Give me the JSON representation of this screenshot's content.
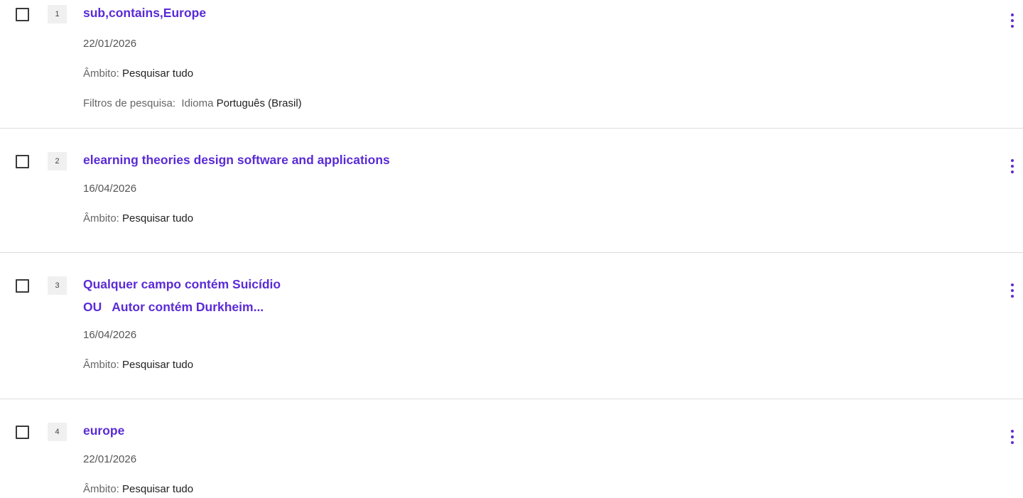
{
  "results": [
    {
      "number": "1",
      "title_lines": [
        "sub,contains,Europe"
      ],
      "date": "22/01/2026",
      "scope_label": "Âmbito:",
      "scope_value": "Pesquisar tudo",
      "filters_label": "Filtros de pesquisa:",
      "filter_name": "Idioma",
      "filter_value": "Português (Brasil)"
    },
    {
      "number": "2",
      "title_lines": [
        "elearning theories design software and applications"
      ],
      "date": "16/04/2026",
      "scope_label": "Âmbito:",
      "scope_value": "Pesquisar tudo"
    },
    {
      "number": "3",
      "title_lines": [
        "Qualquer campo contém Suicídio"
      ],
      "title_operator": "OU",
      "title_second": "Autor contém Durkheim...",
      "date": "16/04/2026",
      "scope_label": "Âmbito:",
      "scope_value": "Pesquisar tudo"
    },
    {
      "number": "4",
      "title_lines": [
        "europe"
      ],
      "date": "22/01/2026",
      "scope_label": "Âmbito:",
      "scope_value": "Pesquisar tudo"
    }
  ],
  "colors": {
    "accent": "#5a2bd6",
    "divider": "#dcdcdc"
  },
  "icons": {
    "more": "more-vertical-icon"
  }
}
